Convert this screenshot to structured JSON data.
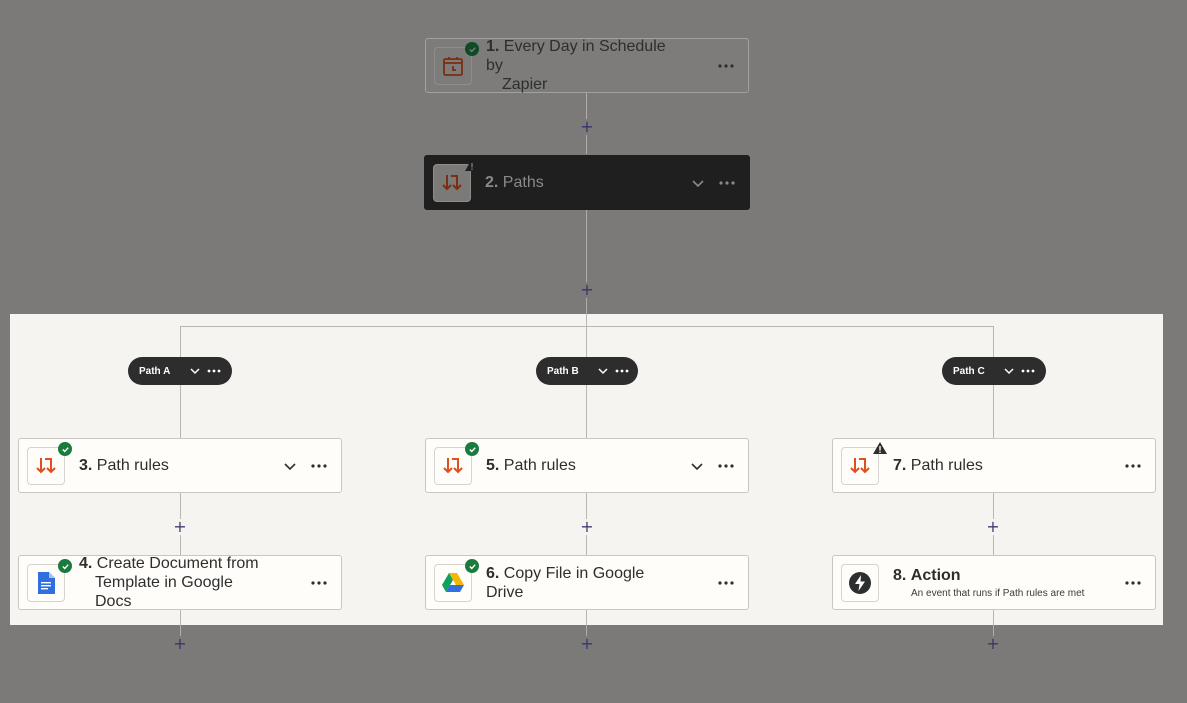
{
  "colors": {
    "canvas": "#7b7a78",
    "highlight": "#f6f4f0",
    "zapier_orange": "#e0501f",
    "success_green": "#1b7a3e",
    "path_pill": "#2d2d2d",
    "plus": "#403f6e"
  },
  "add_step_symbol": "+",
  "steps": {
    "s1": {
      "number": "1.",
      "title_line1": "Every Day in Schedule by",
      "title_line2": "Zapier",
      "icon": "calendar-clock-icon",
      "status": "success"
    },
    "s2": {
      "number": "2.",
      "title": "Paths",
      "icon": "paths-icon",
      "status": "warning"
    },
    "s3": {
      "number": "3.",
      "title": "Path rules",
      "icon": "paths-icon",
      "status": "success"
    },
    "s4": {
      "number": "4.",
      "title_line1": "Create Document from",
      "title_line2": "Template in Google Docs",
      "icon": "google-docs-icon",
      "status": "success"
    },
    "s5": {
      "number": "5.",
      "title": "Path rules",
      "icon": "paths-icon",
      "status": "success"
    },
    "s6": {
      "number": "6.",
      "title": "Copy File in Google Drive",
      "icon": "google-drive-icon",
      "status": "success"
    },
    "s7": {
      "number": "7.",
      "title": "Path rules",
      "icon": "paths-icon",
      "status": "warning"
    },
    "s8": {
      "number": "8.",
      "title": "Action",
      "subtitle": "An event that runs if Path rules are met",
      "icon": "lightning-bolt-icon",
      "status": "none"
    }
  },
  "paths": {
    "a": {
      "label": "Path A"
    },
    "b": {
      "label": "Path B"
    },
    "c": {
      "label": "Path C"
    }
  }
}
